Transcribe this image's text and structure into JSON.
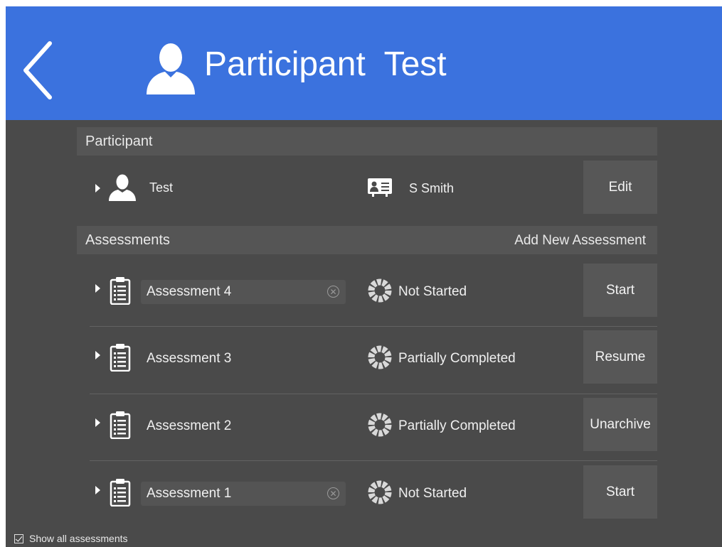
{
  "header": {
    "title": "Participant  Test",
    "back_icon": "chevron-left-icon",
    "avatar_icon": "person-icon",
    "bg_color": "#3b72de"
  },
  "participant_section": {
    "heading": "Participant",
    "row": {
      "name": "Test",
      "contact_icon": "id-card-icon",
      "contact_name": "S Smith",
      "action_label": "Edit"
    }
  },
  "assessments_section": {
    "heading": "Assessments",
    "add_label": "Add New Assessment",
    "items": [
      {
        "name": "Assessment 4",
        "status": "Not Started",
        "action": "Start",
        "editable": true
      },
      {
        "name": "Assessment 3",
        "status": "Partially Completed",
        "action": "Resume",
        "editable": false
      },
      {
        "name": "Assessment 2",
        "status": "Partially Completed",
        "action": "Unarchive",
        "editable": false
      },
      {
        "name": "Assessment 1",
        "status": "Not Started",
        "action": "Start",
        "editable": true
      }
    ]
  },
  "footer": {
    "checkbox_label": "Show all assessments",
    "checked": true
  }
}
